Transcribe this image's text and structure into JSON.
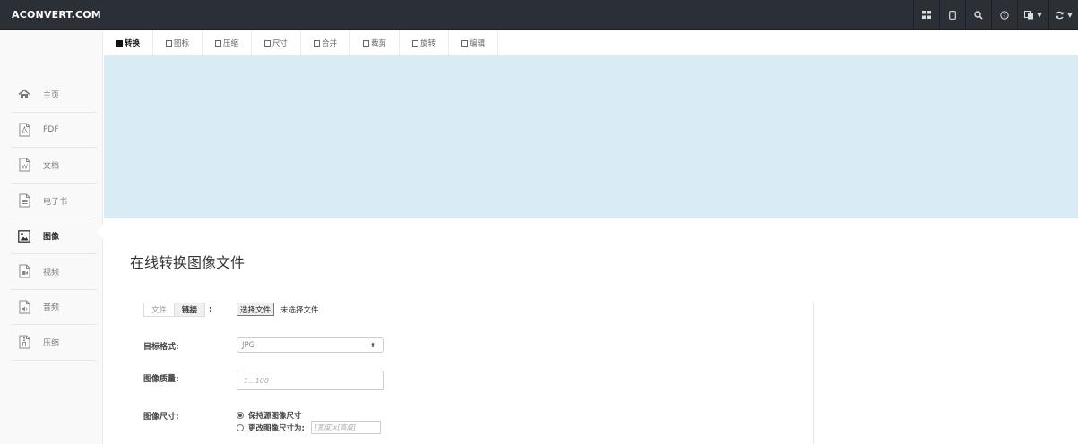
{
  "brand": {
    "name": "ACONVERT.COM"
  },
  "navbar": {
    "icons": [
      {
        "name": "grid-icon"
      },
      {
        "name": "tablet-icon"
      },
      {
        "name": "search-icon"
      },
      {
        "name": "help-icon"
      },
      {
        "name": "language-icon"
      },
      {
        "name": "refresh-icon"
      }
    ]
  },
  "sidebar": {
    "items": [
      {
        "label": "主页",
        "icon": "home-icon",
        "active": false
      },
      {
        "label": "PDF",
        "icon": "pdf-file-icon",
        "active": false
      },
      {
        "label": "文档",
        "icon": "word-file-icon",
        "active": false
      },
      {
        "label": "电子书",
        "icon": "ebook-file-icon",
        "active": false
      },
      {
        "label": "图像",
        "icon": "image-file-icon",
        "active": true
      },
      {
        "label": "视频",
        "icon": "video-file-icon",
        "active": false
      },
      {
        "label": "音频",
        "icon": "audio-file-icon",
        "active": false
      },
      {
        "label": "压缩",
        "icon": "archive-file-icon",
        "active": false
      }
    ]
  },
  "tabs": [
    {
      "label": "转换",
      "active": true
    },
    {
      "label": "图标",
      "active": false
    },
    {
      "label": "压缩",
      "active": false
    },
    {
      "label": "尺寸",
      "active": false
    },
    {
      "label": "合并",
      "active": false
    },
    {
      "label": "裁剪",
      "active": false
    },
    {
      "label": "旋转",
      "active": false
    },
    {
      "label": "编辑",
      "active": false
    }
  ],
  "main": {
    "title": "在线转换图像文件",
    "source": {
      "file_label": "文件",
      "link_label": "链接",
      "colon": ":"
    },
    "file_input": {
      "button_label": "选择文件",
      "status": "未选择文件"
    },
    "target_format": {
      "label": "目标格式:",
      "value": "JPG",
      "arrows": "⬍"
    },
    "quality": {
      "label": "图像质量:",
      "placeholder": "1...100"
    },
    "size": {
      "label": "图像尺寸:",
      "option_keep": "保持源图像尺寸",
      "option_change": "更改图像尺寸为:",
      "size_placeholder": "[宽度]x[高度]"
    }
  }
}
